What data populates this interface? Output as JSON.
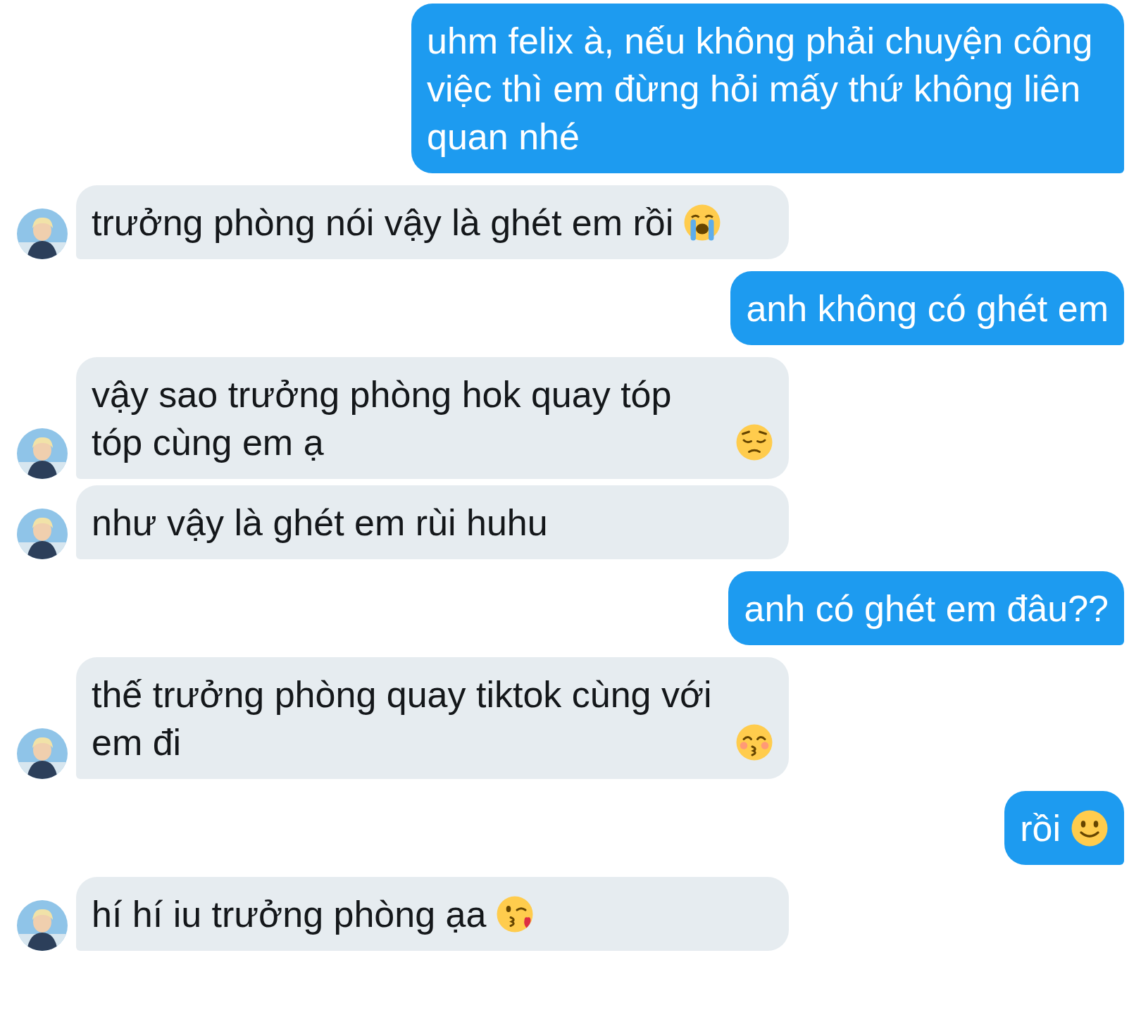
{
  "messages": [
    {
      "kind": "outgoing",
      "text": "uhm felix à, nếu không phải chuyện công việc thì em đừng hỏi mấy thứ không liên quan nhé"
    },
    {
      "kind": "incoming",
      "text": "trưởng phòng nói vậy là ghét em rồi",
      "emoji": {
        "kind": "crying"
      }
    },
    {
      "kind": "outgoing",
      "text": "anh không có ghét em"
    },
    {
      "kind": "incoming",
      "text": "vậy sao trưởng phòng hok quay tóp tóp cùng em ạ",
      "emoji": {
        "kind": "pensive"
      }
    },
    {
      "kind": "incoming",
      "text": "như vậy là ghét em rùi huhu"
    },
    {
      "kind": "outgoing",
      "text": "anh có ghét em đâu??"
    },
    {
      "kind": "incoming",
      "text": "thế trưởng phòng quay tiktok cùng với em đi",
      "emoji": {
        "kind": "kissing"
      }
    },
    {
      "kind": "outgoing",
      "text": "rồi",
      "emoji": {
        "kind": "smile"
      }
    },
    {
      "kind": "incoming",
      "text": "hí hí iu trưởng phòng ạa",
      "emoji": {
        "kind": "kiss-heart"
      }
    }
  ]
}
